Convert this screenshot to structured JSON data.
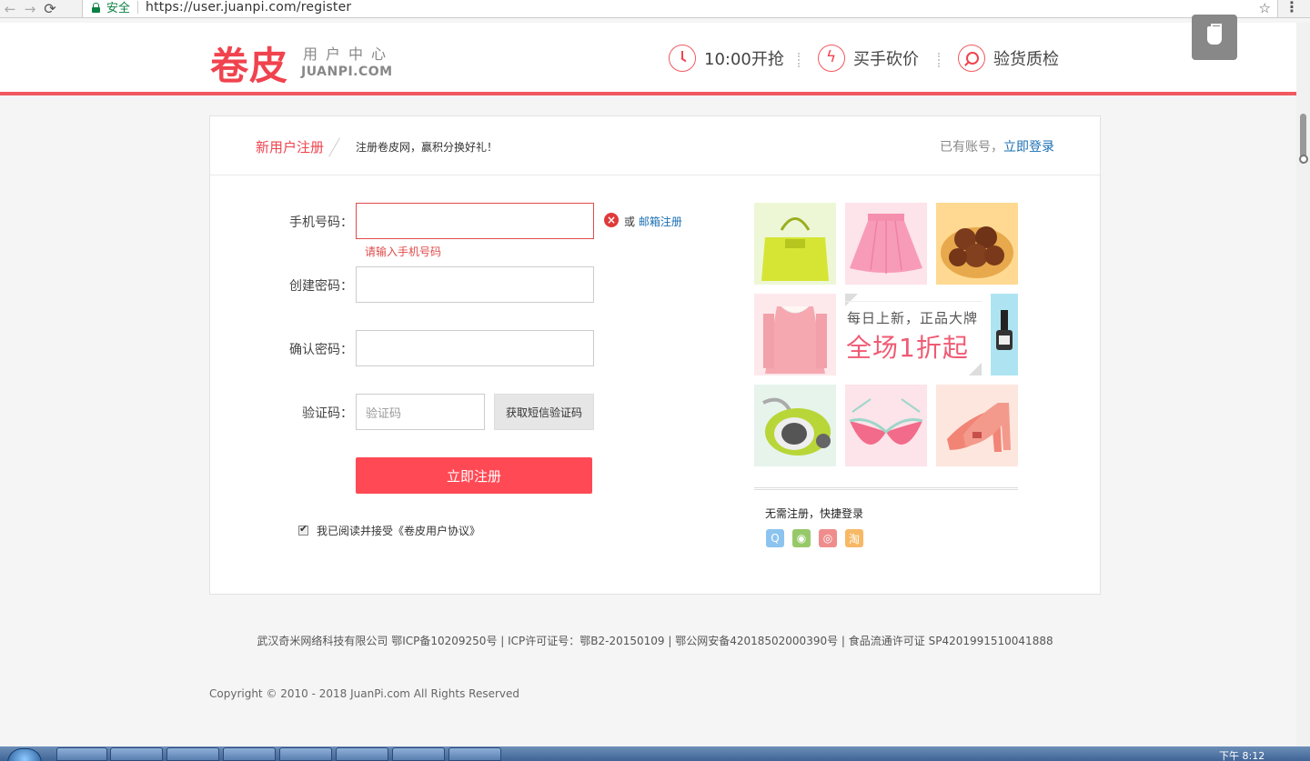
{
  "browser": {
    "secure_label": "安全",
    "url": "https://user.juanpi.com/register",
    "back": "←",
    "forward": "→",
    "reload": "⟳",
    "star": "☆",
    "menu": "⋮"
  },
  "header": {
    "logo_cn": "卷皮",
    "logo_sub_cn": "用户中心",
    "logo_sub_en": "JUANPI.COM",
    "features": [
      {
        "label": "10:00开抢",
        "icon": "clock-icon"
      },
      {
        "label": "买手砍价",
        "icon": "bolt-icon"
      },
      {
        "label": "验货质检",
        "icon": "search-icon"
      }
    ]
  },
  "panel": {
    "title": "新用户注册",
    "subtitle": "注册卷皮网，赢积分换好礼！",
    "login_prompt": "已有账号，",
    "login_link": "立即登录"
  },
  "form": {
    "phone_label": "手机号码：",
    "phone_value": "",
    "phone_error": "请输入手机号码",
    "or_text": "或",
    "email_register": "邮箱注册",
    "password_label": "创建密码：",
    "password_value": "",
    "confirm_label": "确认密码：",
    "confirm_value": "",
    "code_label": "验证码：",
    "code_placeholder": "验证码",
    "sms_button": "获取短信验证码",
    "submit_button": "立即注册",
    "agree_text": "我已阅读并接受《卷皮用户协议》",
    "agree_checked": true
  },
  "promo": {
    "banner_line1": "每日上新，正品大牌",
    "banner_line2": "全场1折起",
    "tiles": [
      "handbag",
      "pink-skirt",
      "chestnuts",
      "pink-jacket",
      "nail-polish",
      "vacuum-cleaner",
      "bra",
      "high-heels"
    ],
    "quick_login_title": "无需注册，快捷登录",
    "social": [
      {
        "name": "qq-icon",
        "glyph": "Q",
        "color": "#8cc4ef"
      },
      {
        "name": "wechat-icon",
        "glyph": "◉",
        "color": "#97c96a"
      },
      {
        "name": "weibo-icon",
        "glyph": "◎",
        "color": "#ef8d8d"
      },
      {
        "name": "taobao-icon",
        "glyph": "淘",
        "color": "#f7b865"
      }
    ]
  },
  "footer": {
    "company": "武汉奇米网络科技有限公司 鄂ICP备10209250号 | ICP许可证号：鄂B2-20150109 | 鄂公网安备42018502000390号 | 食品流通许可证 SP4201991510041888",
    "copyright": "Copyright © 2010 - 2018 JuanPi.com All Rights Reserved"
  },
  "taskbar": {
    "time": "下午 8:12"
  },
  "colors": {
    "brand": "#f0434e",
    "accent_line": "#f0595f",
    "submit": "#ff4a55",
    "link": "#1a6fb3"
  }
}
